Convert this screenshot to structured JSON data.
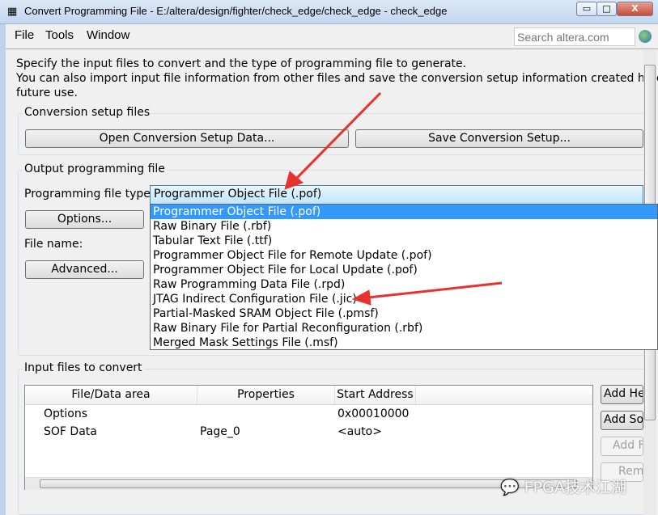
{
  "window": {
    "title": "Convert Programming File - E:/altera/design/fighter/check_edge/check_edge - check_edge",
    "minimize": "▭",
    "maximize": "□",
    "close": "X"
  },
  "menu": [
    "File",
    "Tools",
    "Window"
  ],
  "search": {
    "placeholder": "Search altera.com"
  },
  "intro": [
    "Specify the input files to convert and the type of programming file to generate.",
    "You can also import input file information from other files and save the conversion setup information created here for",
    "future use."
  ],
  "conversion_setup": {
    "label": "Conversion setup files",
    "open": "Open Conversion Setup Data...",
    "save": "Save Conversion Setup..."
  },
  "output": {
    "label": "Output programming file",
    "type_label": "Programming file type:",
    "type_value": "Programmer Object File (.pof)",
    "options": "Options...",
    "file_name_label": "File name:",
    "advanced": "Advanced...",
    "dropdown": [
      "Programmer Object File (.pof)",
      "Raw Binary File (.rbf)",
      "Tabular Text File (.ttf)",
      "Programmer Object File for Remote Update (.pof)",
      "Programmer Object File for Local Update (.pof)",
      "Raw Programming Data File (.rpd)",
      "JTAG Indirect Configuration File (.jic)",
      "Partial-Masked SRAM Object File (.pmsf)",
      "Raw Binary File for Partial Reconfiguration (.rbf)",
      "Merged Mask Settings File (.msf)"
    ]
  },
  "input": {
    "label": "Input files to convert",
    "columns": [
      "File/Data area",
      "Properties",
      "Start Address"
    ],
    "rows": [
      [
        "Options",
        "",
        "0x00010000"
      ],
      [
        "SOF Data",
        "Page_0",
        "<auto>"
      ]
    ],
    "buttons": [
      "Add He",
      "Add So",
      "Add F",
      "Rem"
    ]
  },
  "watermark": "FPGA技术江湖",
  "colors": {
    "selection": "#3399ff",
    "annotation_arrow": "#e8322f"
  }
}
